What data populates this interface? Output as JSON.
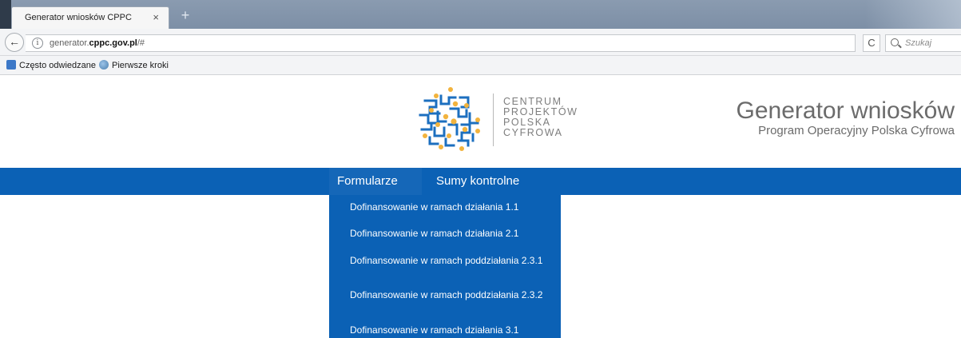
{
  "browser": {
    "tab_title": "Generator wniosków CPPC",
    "tab_close": "×",
    "new_tab": "+",
    "back": "←",
    "info_glyph": "i",
    "url_prefix": "generator.",
    "url_domain": "cppc.gov.pl",
    "url_suffix": "/#",
    "reload": "C",
    "search_placeholder": "Szukaj",
    "bookmarks": [
      {
        "label": "Często odwiedzane",
        "icon": "bookmarks-folder-icon"
      },
      {
        "label": "Pierwsze kroki",
        "icon": "globe-icon"
      }
    ]
  },
  "header": {
    "logo_lines": [
      "CENTRUM",
      "PROJEKTÓW",
      "POLSKA",
      "CYFROWA"
    ],
    "title": "Generator wniosków",
    "subtitle": "Program Operacyjny Polska Cyfrowa",
    "logo_colors": {
      "primary": "#1c6fbf",
      "secondary": "#f2b33d"
    }
  },
  "nav": {
    "items": [
      {
        "label": "Formularze",
        "active": true
      },
      {
        "label": "Sumy kontrolne",
        "active": false
      }
    ],
    "dropdown": [
      "Dofinansowanie w ramach działania 1.1",
      "Dofinansowanie w ramach działania 2.1",
      "Dofinansowanie w ramach poddziałania 2.3.1",
      "Dofinansowanie w ramach poddziałania 2.3.2",
      "Dofinansowanie w ramach działania 3.1"
    ]
  },
  "colors": {
    "nav_blue": "#0b61b5",
    "title_gray": "#6b6b6b"
  }
}
